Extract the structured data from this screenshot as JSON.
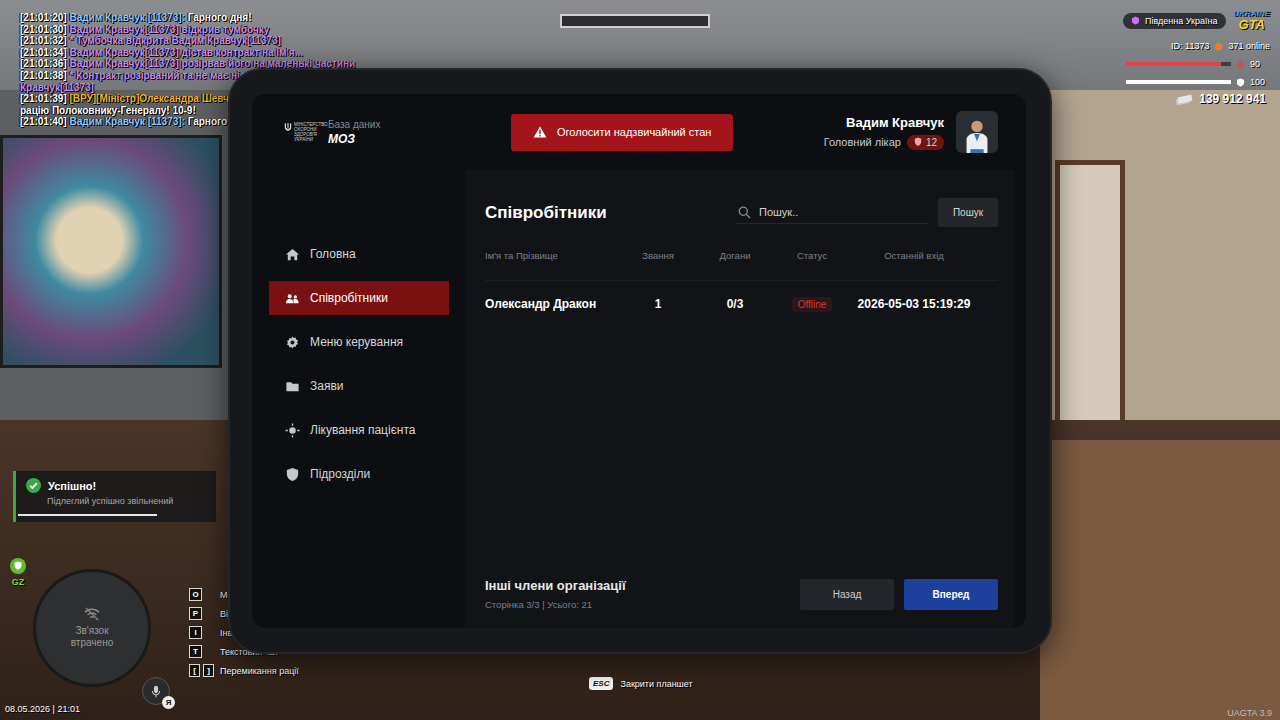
{
  "hud": {
    "chat": [
      {
        "parts": [
          {
            "text": "[21:01:20]",
            "color": "#ffffff"
          },
          {
            "text": " Вадим Кравчук [11373]:",
            "color": "#8fc8ff"
          },
          {
            "text": " Гарного дня!",
            "color": "#ffffff"
          }
        ]
      },
      {
        "parts": [
          {
            "text": "[21:01:30]",
            "color": "#ffffff"
          },
          {
            "text": " Вадим Кравчук[11373] відкрив тумбочку",
            "color": "#c78bf0"
          }
        ]
      },
      {
        "parts": [
          {
            "text": "[21:01:32]",
            "color": "#ffffff"
          },
          {
            "text": " * Тумбочка відкрита Вадим Кравчук[11373]",
            "color": "#c78bf0"
          }
        ]
      },
      {
        "parts": [
          {
            "text": "[21:01:34]",
            "color": "#ffffff"
          },
          {
            "text": " Вадим Кравчук[11373] дістав контракт на ім'я...",
            "color": "#c78bf0"
          }
        ]
      },
      {
        "parts": [
          {
            "text": "[21:01:36]",
            "color": "#ffffff"
          },
          {
            "text": " Вадим Кравчук[11373] розірвав його на маленькі частини",
            "color": "#c78bf0"
          }
        ]
      },
      {
        "parts": [
          {
            "text": "[21:01:38]",
            "color": "#ffffff"
          },
          {
            "text": " * Контракт розірваний та не має ніякої юридичної цінності. Вадим Кравчук[11373]",
            "color": "#c78bf0"
          }
        ]
      },
      {
        "parts": [
          {
            "text": "[21:01:39]",
            "color": "#ffffff"
          },
          {
            "text": " [ВРУ][Міністр]Олександра Шевченко [10532]:",
            "color": "#f0b429"
          },
          {
            "text": " Можете передати рацію Полоковнику-Генералу! 10-9!",
            "color": "#ffffff"
          }
        ]
      },
      {
        "parts": [
          {
            "text": "[21:01:40]",
            "color": "#ffffff"
          },
          {
            "text": " Вадим Кравчук [11373]:",
            "color": "#8fc8ff"
          },
          {
            "text": " Гарного дня!",
            "color": "#ffffff"
          }
        ]
      }
    ],
    "server": "Південна Україна",
    "logo": {
      "top": "UKRAINE",
      "bottom": "GTA"
    },
    "player_id": "ID: 11373",
    "online": "371 online",
    "health": {
      "value": "90",
      "level": 0.9
    },
    "armor": {
      "value": "100",
      "level": 1.0
    },
    "money": "139 912 941",
    "notification": {
      "title": "Успішно!",
      "text": "Підлеглий успішно звільнений",
      "level": 0.73
    },
    "zone": "GZ",
    "minimap": "Зв'язок втрачено",
    "voice_badge": "Я",
    "datetime": "08.05.2026 | 21:01",
    "keys": [
      {
        "keys": [
          "O"
        ],
        "label": "Мен"
      },
      {
        "keys": [
          "P"
        ],
        "label": "Відк"
      },
      {
        "keys": [
          "I"
        ],
        "label": "Інвент."
      },
      {
        "keys": [
          "T"
        ],
        "label": "Текстовий чат"
      },
      {
        "keys": [
          "[",
          "]"
        ],
        "label": "Перемикання рації"
      }
    ],
    "close_hint": {
      "key": "ESC",
      "label": "Закрити планшет"
    },
    "version": "UAGTA 3.9"
  },
  "tablet": {
    "emblem": "МІНІСТЕРСТВО ОХОРОНИ ЗДОРОВ'Я УКРАЇНИ",
    "app_subtitle": "База даних",
    "app_title": "МОЗ",
    "emergency_button": "Оголосити надзвичайний стан",
    "user": {
      "name": "Вадим Кравчук",
      "role": "Головний лікар",
      "rank": "12"
    },
    "sidebar": [
      {
        "label": "Головна",
        "selected": false
      },
      {
        "label": "Співробітники",
        "selected": true
      },
      {
        "label": "Меню керування",
        "selected": false
      },
      {
        "label": "Заяви",
        "selected": false
      },
      {
        "label": "Лікування пацієнта",
        "selected": false
      },
      {
        "label": "Підрозділи",
        "selected": false
      }
    ],
    "page_title": "Співробітники",
    "search": {
      "placeholder": "Пошук..",
      "button": "Пошук"
    },
    "table": {
      "columns": [
        "Ім'я та Прізвище",
        "Звання",
        "Догани",
        "Статус",
        "Останній вхід"
      ],
      "rows": [
        {
          "name": "Олександр Дракон",
          "rank": "1",
          "reprimands": "0/3",
          "status": "Offline",
          "online": false,
          "last_login": "2026-05-03 15:19:29"
        }
      ]
    },
    "footer": {
      "title": "Інші члени організації",
      "pagination": "Сторінка 3/3 | Усього: 21"
    },
    "buttons": [
      {
        "label": "Назад",
        "kind": "secondary"
      },
      {
        "label": "Вперед",
        "kind": "primary"
      }
    ]
  }
}
